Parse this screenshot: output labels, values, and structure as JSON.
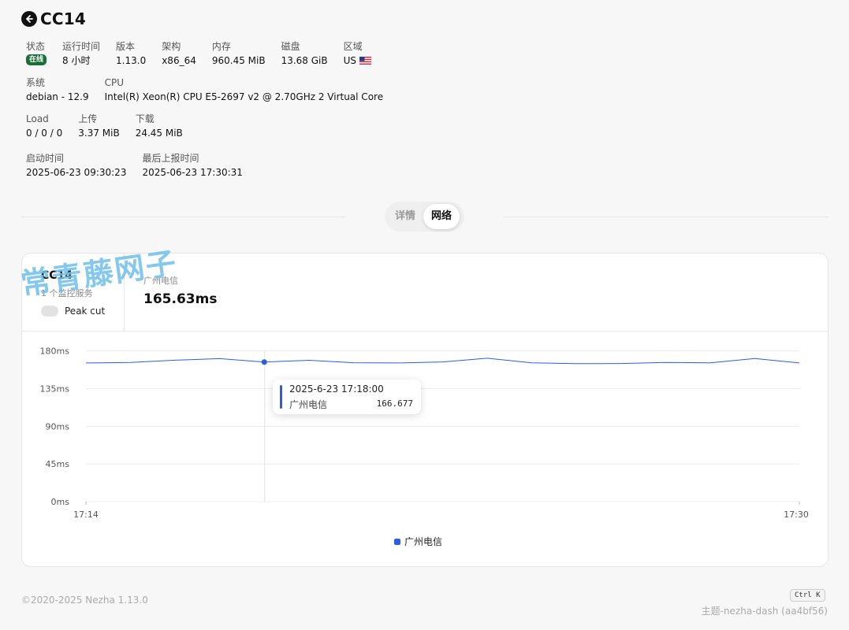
{
  "server": {
    "name": "CC14"
  },
  "info": {
    "status_label": "状态",
    "status_value": "在线",
    "uptime_label": "运行时间",
    "uptime_value": "8 小时",
    "version_label": "版本",
    "version_value": "1.13.0",
    "arch_label": "架构",
    "arch_value": "x86_64",
    "memory_label": "内存",
    "memory_value": "960.45 MiB",
    "disk_label": "磁盘",
    "disk_value": "13.68 GiB",
    "region_label": "区域",
    "region_value": "US",
    "system_label": "系统",
    "system_value": "debian - 12.9",
    "cpu_label": "CPU",
    "cpu_value": "Intel(R) Xeon(R) CPU E5-2697 v2 @ 2.70GHz 2 Virtual Core",
    "load_label": "Load",
    "load_value": "0 / 0 / 0",
    "upload_label": "上传",
    "upload_value": "3.37 MiB",
    "download_label": "下载",
    "download_value": "24.45 MiB",
    "boot_label": "启动时间",
    "boot_value": "2025-06-23 09:30:23",
    "lastreport_label": "最后上报时间",
    "lastreport_value": "2025-06-23 17:30:31"
  },
  "tabs": [
    {
      "label": "详情"
    },
    {
      "label": "网络"
    }
  ],
  "card": {
    "name": "CC14",
    "monitor_count": "1 个监控服务",
    "peak_label": "Peak cut",
    "latency_label": "广州电信",
    "latency_value": "165.63ms"
  },
  "watermark": "常青藤网子",
  "tooltip": {
    "time": "2025-6-23 17:18:00",
    "series": "广州电信",
    "value": "166.677"
  },
  "chart_data": {
    "type": "line",
    "x": [
      "17:14",
      "17:15",
      "17:16",
      "17:17",
      "17:18",
      "17:19",
      "17:20",
      "17:21",
      "17:22",
      "17:23",
      "17:24",
      "17:25",
      "17:26",
      "17:27",
      "17:28",
      "17:29",
      "17:30"
    ],
    "x_tick_labels": [
      "17:14",
      "17:30"
    ],
    "y_tick_labels": [
      "0ms",
      "45ms",
      "90ms",
      "135ms",
      "180ms"
    ],
    "y_ticks": [
      0,
      45,
      90,
      135,
      180
    ],
    "ylim": [
      0,
      190
    ],
    "series": [
      {
        "name": "广州电信",
        "color": "#2c5fdc",
        "values": [
          165.6,
          166.2,
          168.9,
          170.8,
          166.7,
          168.8,
          165.9,
          165.6,
          166.9,
          171.3,
          165.8,
          164.8,
          165.0,
          166.3,
          165.8,
          170.9,
          165.6
        ]
      }
    ],
    "highlight_index": 4,
    "legend_position": "bottom-center",
    "grid": true
  },
  "footer": {
    "copyright": "©2020-2025 Nezha 1.13.0",
    "shortcut": "Ctrl K",
    "theme": "主题-nezha-dash (aa4bf56)"
  }
}
